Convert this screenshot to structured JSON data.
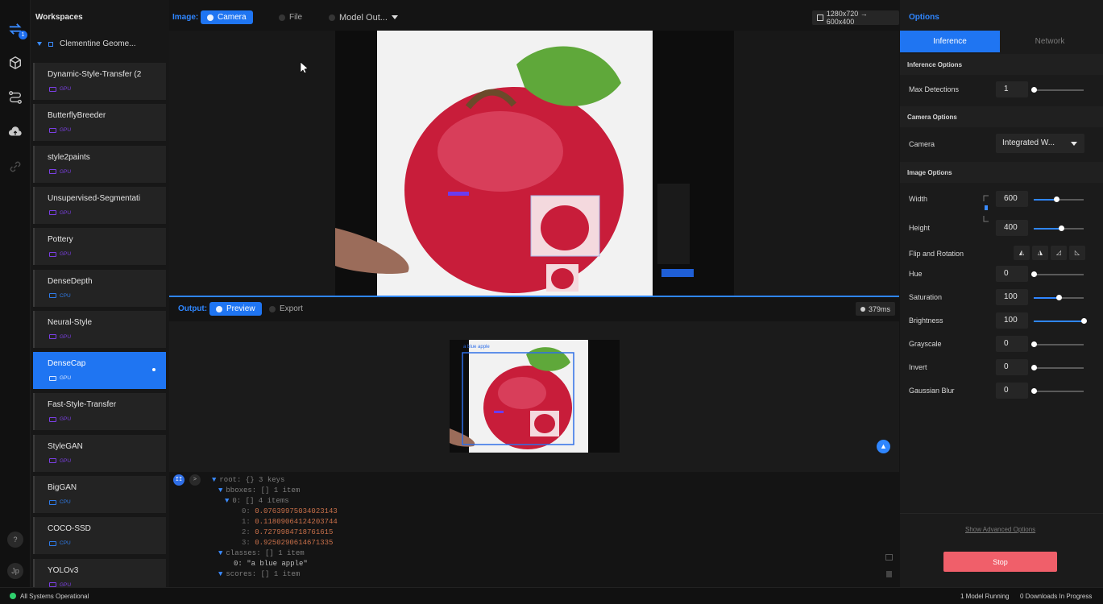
{
  "workspaces": {
    "title": "Workspaces",
    "group": "Clementine Geome...",
    "items": [
      {
        "name": "Dynamic-Style-Transfer (2",
        "hw": "GPU"
      },
      {
        "name": "ButterflyBreeder",
        "hw": "GPU"
      },
      {
        "name": "style2paints",
        "hw": "GPU"
      },
      {
        "name": "Unsupervised-Segmentati",
        "hw": "GPU"
      },
      {
        "name": "Pottery",
        "hw": "GPU"
      },
      {
        "name": "DenseDepth",
        "hw": "CPU"
      },
      {
        "name": "Neural-Style",
        "hw": "GPU"
      },
      {
        "name": "DenseCap",
        "hw": "GPU"
      },
      {
        "name": "Fast-Style-Transfer",
        "hw": "GPU"
      },
      {
        "name": "StyleGAN",
        "hw": "GPU"
      },
      {
        "name": "BigGAN",
        "hw": "CPU"
      },
      {
        "name": "COCO-SSD",
        "hw": "CPU"
      },
      {
        "name": "YOLOv3",
        "hw": "GPU"
      }
    ],
    "active_index": 7
  },
  "rail": {
    "icons": [
      "swap-icon",
      "cube-icon",
      "flow-icon",
      "cloud-upload-icon",
      "link-icon"
    ],
    "badge": "1",
    "help": "?",
    "avatar": "Jp"
  },
  "image_bar": {
    "label": "Image:",
    "camera": "Camera",
    "file": "File",
    "model_output": "Model Out...",
    "resolution": "1280x720 → 600x400"
  },
  "output_bar": {
    "label": "Output:",
    "preview": "Preview",
    "export": "Export",
    "latency": "379ms"
  },
  "detection_label": "a blue apple",
  "json_tree": {
    "root": "root: {} 3 keys",
    "bboxes": "bboxes: [] 1 item",
    "bbox0": "0: [] 4 items",
    "values": [
      "0.07639975034023143",
      "0.11809064124203744",
      "0.7279984718761615",
      "0.9250290614671335"
    ],
    "classes": "classes: [] 1 item",
    "class0": "0: \"a blue apple\"",
    "scores": "scores: [] 1 item"
  },
  "options": {
    "title": "Options",
    "tabs": {
      "inference": "Inference",
      "network": "Network"
    },
    "inference_section": "Inference Options",
    "max_detections": {
      "label": "Max Detections",
      "value": "1",
      "level": 0.0
    },
    "camera_section": "Camera Options",
    "camera": {
      "label": "Camera",
      "value": "Integrated W..."
    },
    "image_section": "Image Options",
    "width": {
      "label": "Width",
      "value": "600",
      "level": 0.45
    },
    "height": {
      "label": "Height",
      "value": "400",
      "level": 0.55
    },
    "flip_label": "Flip and Rotation",
    "hue": {
      "label": "Hue",
      "value": "0",
      "level": 0.0
    },
    "saturation": {
      "label": "Saturation",
      "value": "100",
      "level": 0.5
    },
    "brightness": {
      "label": "Brightness",
      "value": "100",
      "level": 1.0
    },
    "grayscale": {
      "label": "Grayscale",
      "value": "0",
      "level": 0.0
    },
    "invert": {
      "label": "Invert",
      "value": "0",
      "level": 0.0
    },
    "gaussian_blur": {
      "label": "Gaussian Blur",
      "value": "0",
      "level": 0.0
    },
    "show_advanced": "Show Advanced Options",
    "stop": "Stop"
  },
  "status": {
    "systems": "All Systems Operational",
    "models_running": "1 Model Running",
    "downloads": "0 Downloads In Progress"
  },
  "colors": {
    "accent": "#1f75f2",
    "stop": "#f05f6a",
    "ok": "#2fcf6d",
    "gpu": "#7b3fe4",
    "cpu": "#2f7be8"
  }
}
